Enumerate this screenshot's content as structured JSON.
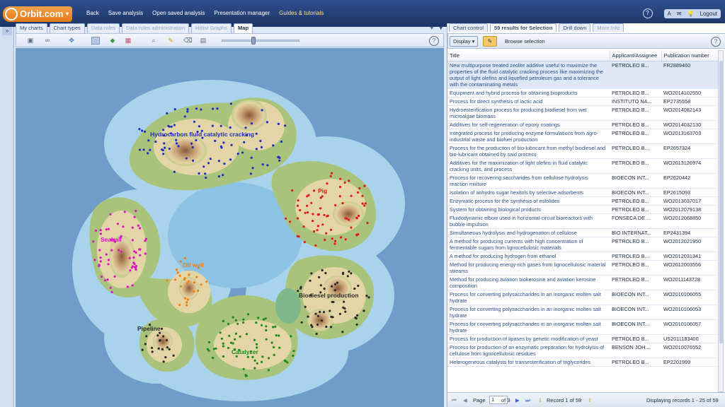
{
  "app": {
    "logo": "Orbit.com",
    "logo_arrow": "▾"
  },
  "menu": {
    "items": [
      "Back",
      "Save analysis",
      "Open saved analysis",
      "Presentation manager"
    ],
    "guides": "Guides & tutorials"
  },
  "top_right": {
    "help": "?",
    "font_icon": "A",
    "mail_icon": "✉",
    "bulb_icon": "💡",
    "logout": "Logout"
  },
  "gutter": {
    "expand": "»"
  },
  "left_tabs": [
    {
      "label": "My charts",
      "state": "normal"
    },
    {
      "label": "Chart types",
      "state": "normal"
    },
    {
      "label": "Data rules",
      "state": "dim"
    },
    {
      "label": "Data rules administration",
      "state": "dim"
    },
    {
      "label": "Hitlist Graphs",
      "state": "dim"
    },
    {
      "label": "Map",
      "state": "active"
    }
  ],
  "tab_controls": {
    "add": "+",
    "menu": "▾"
  },
  "map_tools": {
    "help": "?"
  },
  "map_labels": [
    {
      "text": "Hydrocarbon fluid catalytic cracking",
      "color": "#1f2fbf"
    },
    {
      "text": "Pig",
      "color": "#e01a1a"
    },
    {
      "text": "Seaball",
      "color": "#e010c8"
    },
    {
      "text": "Oil well",
      "color": "#f08010"
    },
    {
      "text": "Biodiesel production",
      "color": "#2a2a2a"
    },
    {
      "text": "Pipeline",
      "color": "#2a2a2a"
    },
    {
      "text": "Catalyzer",
      "color": "#1d8a1d"
    }
  ],
  "right_tabs": [
    "Chart control",
    "59 results for Selection",
    "Drill down",
    "More Info"
  ],
  "right_toolbar": {
    "display": "Display ▾",
    "browse": "Browse selection",
    "help": "?"
  },
  "table": {
    "headers": [
      "Title",
      "Applicant/Assignee",
      "Publication number"
    ],
    "rows": [
      [
        "New multipurpose treated zeolite additive useful to maximize the properties of the fluid catalytic cracking process like maximizing the output of light olefins and liquefied petroleum gas and a tolerance with the contaminating metals",
        "PETROLEO B...",
        "FR2889460"
      ],
      [
        "Equipment and hybrid process for obtaining bioproducts",
        "PETROLEO B...",
        "WO2014102550"
      ],
      [
        "Process for direct synthesis of lactic acid",
        "INSTITUTO NA...",
        "EP2735558"
      ],
      [
        "Hydroesterification process for producing biodiesel from wet microalgae biomass",
        "PETROLEO B...",
        "WO2014082143"
      ],
      [
        "Additives for self-regeneration of epoxy coatings",
        "PETROLEO B...",
        "WO2014032130"
      ],
      [
        "Integrated process for producing enzyme formulations from agro-industrial waste and biofuel production",
        "PETROLEO B...",
        "WO2013163703"
      ],
      [
        "Process for the production of bio-lubricant from methyl biodiesel and bio-lubricant obtained by said process",
        "PETROLEO B...",
        "EP2657324"
      ],
      [
        "Additives for the maximization of light olefins in fluid catalytic cracking units, and process",
        "PETROLEO B...",
        "WO2013126974"
      ],
      [
        "Process for recovering saccharides from cellulose hydrolysis reaction mixture",
        "BIOECON INT...",
        "EP2620442"
      ],
      [
        "Isolation of anhydro sugar hexitols by selective adsorbents",
        "BIOECON INT...",
        "EP2615093"
      ],
      [
        "Enzymatic process for the synthesis of estolides",
        "PETROLEO B...",
        "WO2013037017"
      ],
      [
        "System for obtaining biological products",
        "PETROLEO B...",
        "WO2012079138"
      ],
      [
        "Fluidodynamic elbow used in horizontal-circuit bioreactors with bubble impulsion",
        "FONSECA DE ...",
        "WO2012068850"
      ],
      [
        "Simultaneous hydrolysis and hydrogenation of cellulose",
        "BIO INTERNAT...",
        "EP2431394"
      ],
      [
        "A method for producing currents with high concentration of fermentable sugars from lignocellulosic materials",
        "PETROLEO B...",
        "WO2012021950"
      ],
      [
        "A method for producing hydrogen from ethanol",
        "PETROLEO B...",
        "WO2012031341"
      ],
      [
        "Method for producing energy-rich gases from lignocellulosic material streams",
        "PETROLEO B...",
        "WO2012003556"
      ],
      [
        "Method for producing aviation biokerosine and aviation kerosine composition",
        "PETROLEO B...",
        "WO2011143728"
      ],
      [
        "Process for converting polysaccharides in an inorganic molten salt hydrate",
        "BIOECON INT...",
        "WO2010106055"
      ],
      [
        "Process for converting polysaccharides in an inorganic molten salt hydrate",
        "BIOECON INT...",
        "WO2010106053"
      ],
      [
        "Process for converting polysaccharides in an inorganic molten salt hydrate",
        "BIOECON INT...",
        "WO2010106057"
      ],
      [
        "Process for production of lipases by genetic modification of yeast",
        "PETROLEO B...",
        "US2011183400"
      ],
      [
        "Process for production of an enzymatic preparation for hydrolysis of cellulose from lignocellulosic residues",
        "BENSON JOH...",
        "WO2010076552"
      ],
      [
        "Heterogeneous catalysts for transesterification of triglycerides",
        "PETROLEO B...",
        "EP2201999"
      ]
    ]
  },
  "pager": {
    "page_label": "Page",
    "page_value": "1",
    "of": "of 3",
    "record": "Record 1 of 59",
    "displaying": "Displaying records 1 - 25 of 59"
  },
  "colors": {
    "accent": "#e37a16",
    "header": "#1c3564",
    "ocean": "#6d9dc8"
  }
}
